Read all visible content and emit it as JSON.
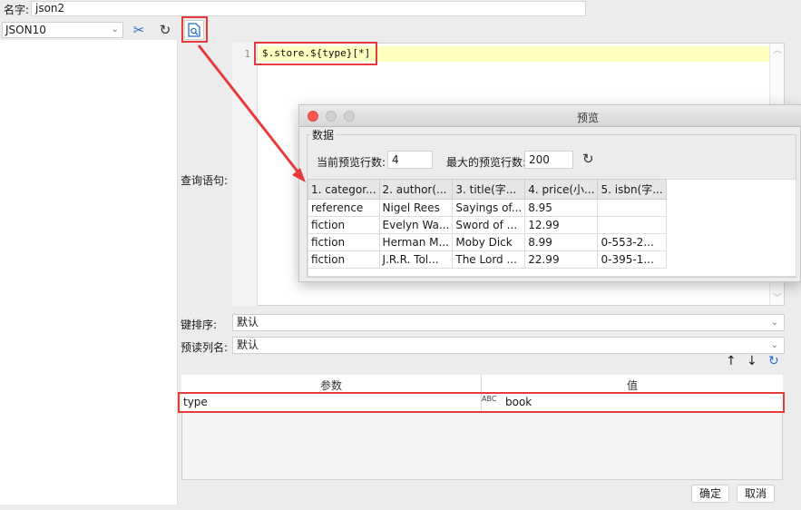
{
  "form": {
    "name_label": "名字:",
    "name_value": "json2",
    "connection": "JSON10",
    "query_label": "查询语句:",
    "key_sort_label": "键排序:",
    "key_sort_value": "默认",
    "col_name_label": "预读列名:",
    "col_name_value": "默认"
  },
  "editor": {
    "line_number": "1",
    "code": "$.store.${type}[*]"
  },
  "preview_dialog": {
    "title": "预览",
    "group_label": "数据",
    "current_rows_label": "当前预览行数:",
    "current_rows_value": "4",
    "max_rows_label": "最大的预览行数:",
    "max_rows_value": "200",
    "columns": [
      "1. categor...",
      "2. author(...",
      "3. title(字...",
      "4. price(小...",
      "5. isbn(字..."
    ],
    "rows": [
      [
        "reference",
        "Nigel Rees",
        "Sayings of...",
        "8.95",
        ""
      ],
      [
        "fiction",
        "Evelyn Wa...",
        "Sword of ...",
        "12.99",
        ""
      ],
      [
        "fiction",
        "Herman M...",
        "Moby Dick",
        "8.99",
        "0-553-2..."
      ],
      [
        "fiction",
        "J.R.R. Tol...",
        "The Lord ...",
        "22.99",
        "0-395-1..."
      ]
    ]
  },
  "params": {
    "header_param": "参数",
    "header_value": "值",
    "row_key": "type",
    "row_type_icon": "ABC",
    "row_value": "book"
  },
  "buttons": {
    "ok": "确定",
    "cancel": "取消"
  },
  "icons": {
    "wrench": "wrench-icon",
    "refresh": "refresh-icon",
    "preview": "preview-icon",
    "up": "arrow-up-icon",
    "down": "arrow-down-icon"
  },
  "colors": {
    "highlight": "#e53b3b",
    "accent": "#1f6fd1"
  }
}
